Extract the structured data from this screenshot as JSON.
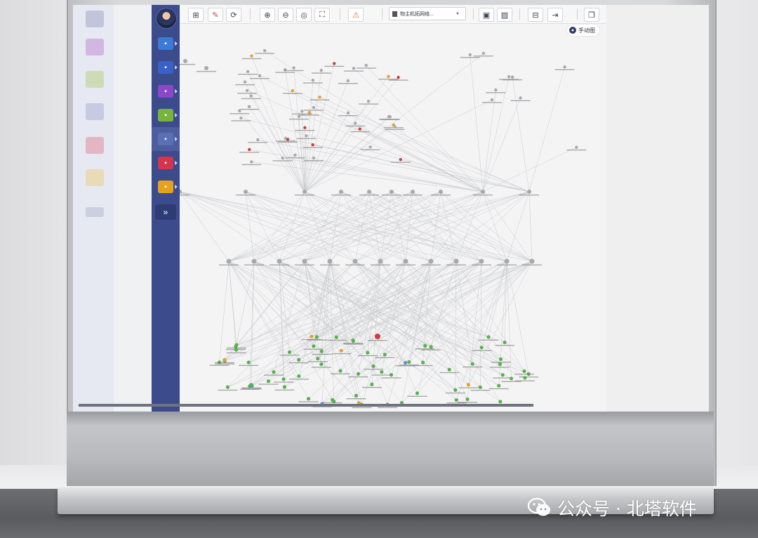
{
  "app": {
    "toolbar": {
      "buttons": [
        {
          "id": "layout",
          "icon": "layout-icon",
          "glyph": "⊞"
        },
        {
          "id": "draw",
          "icon": "pen-icon",
          "glyph": "✎"
        },
        {
          "id": "refresh",
          "icon": "refresh-icon",
          "glyph": "⟳"
        },
        {
          "id": "zoom-in",
          "icon": "zoom-in-icon",
          "glyph": "⊕"
        },
        {
          "id": "zoom-out",
          "icon": "zoom-out-icon",
          "glyph": "⊖"
        },
        {
          "id": "center",
          "icon": "target-icon",
          "glyph": "◎"
        },
        {
          "id": "fit",
          "icon": "fit-screen-icon",
          "glyph": "⛶"
        },
        {
          "id": "alarm",
          "icon": "warning-icon",
          "glyph": "⚠"
        },
        {
          "id": "image",
          "icon": "image-icon",
          "glyph": "▣"
        },
        {
          "id": "snapshot",
          "icon": "photo-icon",
          "glyph": "▨"
        },
        {
          "id": "device",
          "icon": "device-icon",
          "glyph": "⊟"
        },
        {
          "id": "export",
          "icon": "export-icon",
          "glyph": "⇥"
        },
        {
          "id": "window",
          "icon": "window-icon",
          "glyph": "❐"
        }
      ],
      "select_value": "物主机拓网络...",
      "tip_label": "手动图"
    },
    "sidebar": [
      {
        "name": "chart",
        "icon": "chart-icon",
        "color": "#3b7bd6"
      },
      {
        "name": "network",
        "icon": "network-icon",
        "color": "#3a61c6"
      },
      {
        "name": "storage",
        "icon": "storage-icon",
        "color": "#8a49c9"
      },
      {
        "name": "monitor",
        "icon": "monitor-icon",
        "color": "#78b33c"
      },
      {
        "name": "devices",
        "icon": "devices-icon",
        "color": "#5b6fb7"
      },
      {
        "name": "report",
        "icon": "report-icon",
        "color": "#d6334d"
      },
      {
        "name": "settings",
        "icon": "gear-icon",
        "color": "#e5a21d"
      }
    ],
    "expand_label": "»"
  },
  "topology": {
    "colors": {
      "link": "#c9cacd",
      "node_green": "#56b34a",
      "node_red": "#d33c3c",
      "node_orange": "#e6a12a",
      "node_blue": "#5a8fd8",
      "node_gray": "#a8a9ad",
      "text": "#777"
    }
  },
  "watermark": {
    "text": "公众号 · 北塔软件"
  }
}
